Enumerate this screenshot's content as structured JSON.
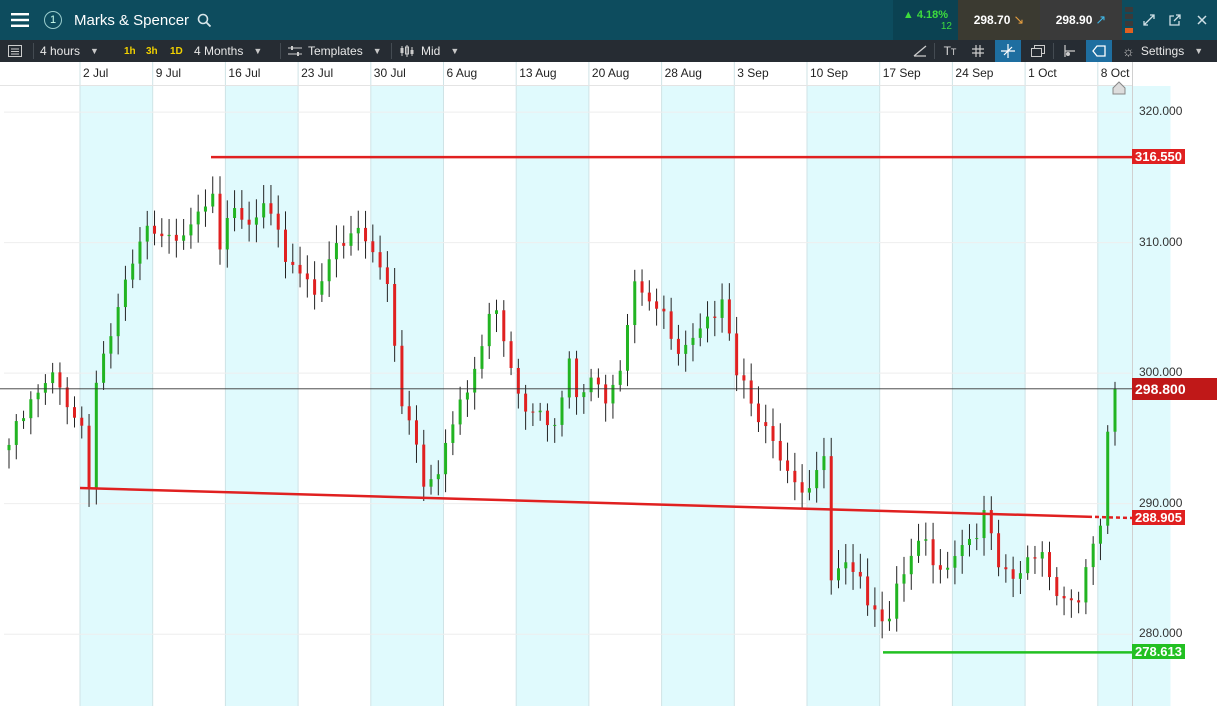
{
  "header": {
    "menu_icon": "hamburger-icon",
    "account_badge": "1",
    "instrument": "Marks & Spencer",
    "search_icon": "search-icon",
    "change_pct": "4.18%",
    "change_count": "12",
    "sell_price": "298.70",
    "buy_price": "298.90",
    "colors": {
      "topbar": "#0d4c5e",
      "sell_bg": "#3a3a2e",
      "buy_bg": "#3a3a3a",
      "up": "#3ddc3d"
    }
  },
  "toolbar": {
    "interval": "4 hours",
    "quick_intervals": [
      "1h",
      "3h",
      "1D"
    ],
    "range": "4 Months",
    "templates": "Templates",
    "price_type": "Mid",
    "settings": "Settings"
  },
  "chart_data": {
    "type": "candlestick",
    "x_tick_labels": [
      "2 Jul",
      "9 Jul",
      "16 Jul",
      "23 Jul",
      "30 Jul",
      "6 Aug",
      "13 Aug",
      "20 Aug",
      "28 Aug",
      "3 Sep",
      "10 Sep",
      "17 Sep",
      "24 Sep",
      "1 Oct",
      "8 Oct"
    ],
    "y_tick_labels": [
      "320.000",
      "310.000",
      "300.000",
      "290.000",
      "280.000"
    ],
    "y_ticks": [
      320,
      310,
      300,
      290,
      280
    ],
    "ylim": [
      274.5,
      322.0
    ],
    "current_price": 298.8,
    "current_price_label": "298.800",
    "horizontal_lines": [
      {
        "label": "316.550",
        "value": 316.55,
        "color": "#e02020"
      },
      {
        "label": "278.613",
        "value": 278.613,
        "color": "#22c022"
      }
    ],
    "trend_line": {
      "start_value": 291.2,
      "end_value": 289.0,
      "label": "288.905",
      "value": 288.905,
      "color": "#e02020"
    },
    "close_path": [
      [
        0,
        294.5
      ],
      [
        3,
        297.5
      ],
      [
        6,
        299.5
      ],
      [
        8,
        298
      ],
      [
        10,
        296
      ],
      [
        11,
        291.3
      ],
      [
        12,
        300
      ],
      [
        14,
        303
      ],
      [
        17,
        308
      ],
      [
        19,
        311
      ],
      [
        20,
        310
      ],
      [
        22,
        310
      ],
      [
        25,
        312
      ],
      [
        28,
        314.5
      ],
      [
        29,
        310
      ],
      [
        31,
        312
      ],
      [
        33,
        311
      ],
      [
        35,
        312.5
      ],
      [
        38,
        309
      ],
      [
        40,
        308
      ],
      [
        42,
        306.5
      ],
      [
        44,
        309
      ],
      [
        46,
        309.5
      ],
      [
        48,
        311
      ],
      [
        50,
        309
      ],
      [
        52,
        307
      ],
      [
        54,
        298
      ],
      [
        56,
        295
      ],
      [
        57,
        292
      ],
      [
        59,
        293
      ],
      [
        61,
        296
      ],
      [
        63,
        298.5
      ],
      [
        65,
        302
      ],
      [
        66,
        304
      ],
      [
        67,
        305.5
      ],
      [
        68,
        303
      ],
      [
        70,
        299
      ],
      [
        71,
        297.5
      ],
      [
        73,
        298
      ],
      [
        75,
        295.5
      ],
      [
        77,
        300.5
      ],
      [
        78,
        298
      ],
      [
        80,
        299
      ],
      [
        82,
        298.5
      ],
      [
        84,
        301
      ],
      [
        86,
        307.5
      ],
      [
        88,
        306
      ],
      [
        90,
        304
      ],
      [
        92,
        301
      ],
      [
        94,
        302
      ],
      [
        96,
        303.5
      ],
      [
        98,
        306.5
      ],
      [
        100,
        300.5
      ],
      [
        102,
        298.5
      ],
      [
        103,
        297
      ],
      [
        105,
        294
      ],
      [
        107,
        292
      ],
      [
        109,
        290
      ],
      [
        111,
        292
      ],
      [
        112,
        294.5
      ],
      [
        113,
        285
      ],
      [
        115,
        286
      ],
      [
        117,
        284.5
      ],
      [
        119,
        281
      ],
      [
        121,
        280.5
      ],
      [
        122,
        283
      ],
      [
        124,
        286
      ],
      [
        126,
        287
      ],
      [
        128,
        285
      ],
      [
        130,
        286.5
      ],
      [
        132,
        287.5
      ],
      [
        134,
        289
      ],
      [
        136,
        285
      ],
      [
        138,
        283.5
      ],
      [
        140,
        285.5
      ],
      [
        142,
        286.5
      ],
      [
        143,
        284.5
      ],
      [
        145,
        283
      ],
      [
        147,
        282.5
      ],
      [
        148,
        285.5
      ],
      [
        150,
        287.5
      ],
      [
        151,
        295.5
      ],
      [
        152,
        298.8
      ]
    ],
    "colors": {
      "up": "#22b422",
      "down": "#e02020",
      "band": "#e0fafd"
    }
  }
}
